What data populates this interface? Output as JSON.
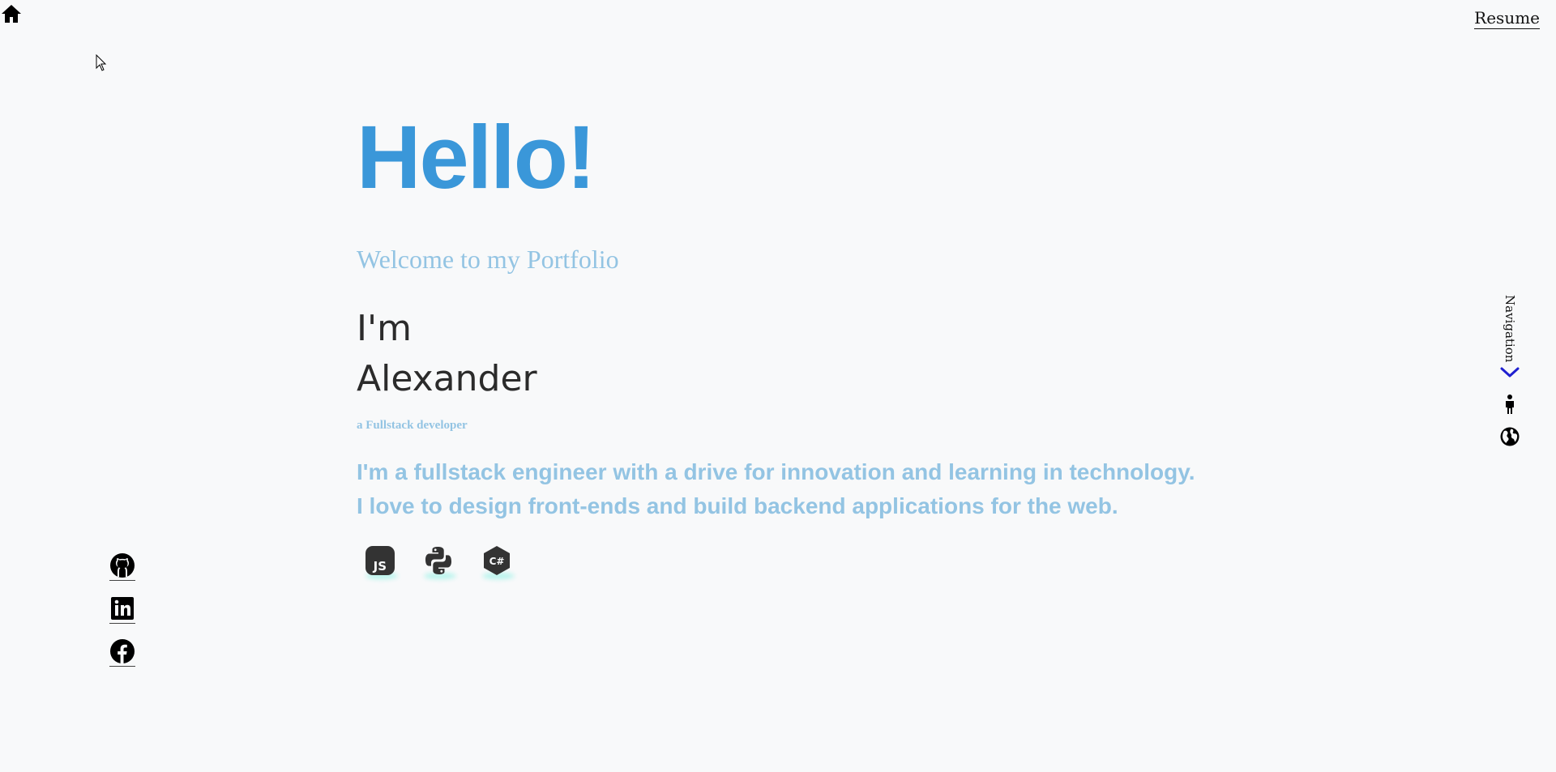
{
  "header": {
    "home_icon": "home-icon",
    "resume_label": "Resume"
  },
  "hero": {
    "greeting": "Hello!",
    "welcome": "Welcome to my Portfolio",
    "intro_line1": "I'm",
    "intro_line2": "Alexander",
    "role": "a Fullstack developer",
    "bio_line1": "I'm a fullstack engineer with a drive for innovation and learning in technology.",
    "bio_line2": "I love to design front-ends and build backend applications for the web."
  },
  "tech_icons": [
    "javascript-icon",
    "python-icon",
    "csharp-icon"
  ],
  "socials": [
    "github-icon",
    "linkedin-icon",
    "facebook-icon"
  ],
  "navigation": {
    "label": "Navigation",
    "chevron_icon": "chevron-down-icon",
    "items": [
      "person-icon",
      "globe-icon"
    ]
  },
  "colors": {
    "accent": "#3a97d9",
    "accent_light": "#93c4e3",
    "chevron": "#2020d0",
    "background": "#f8f9fa",
    "text_dark": "#2b2b2b"
  }
}
